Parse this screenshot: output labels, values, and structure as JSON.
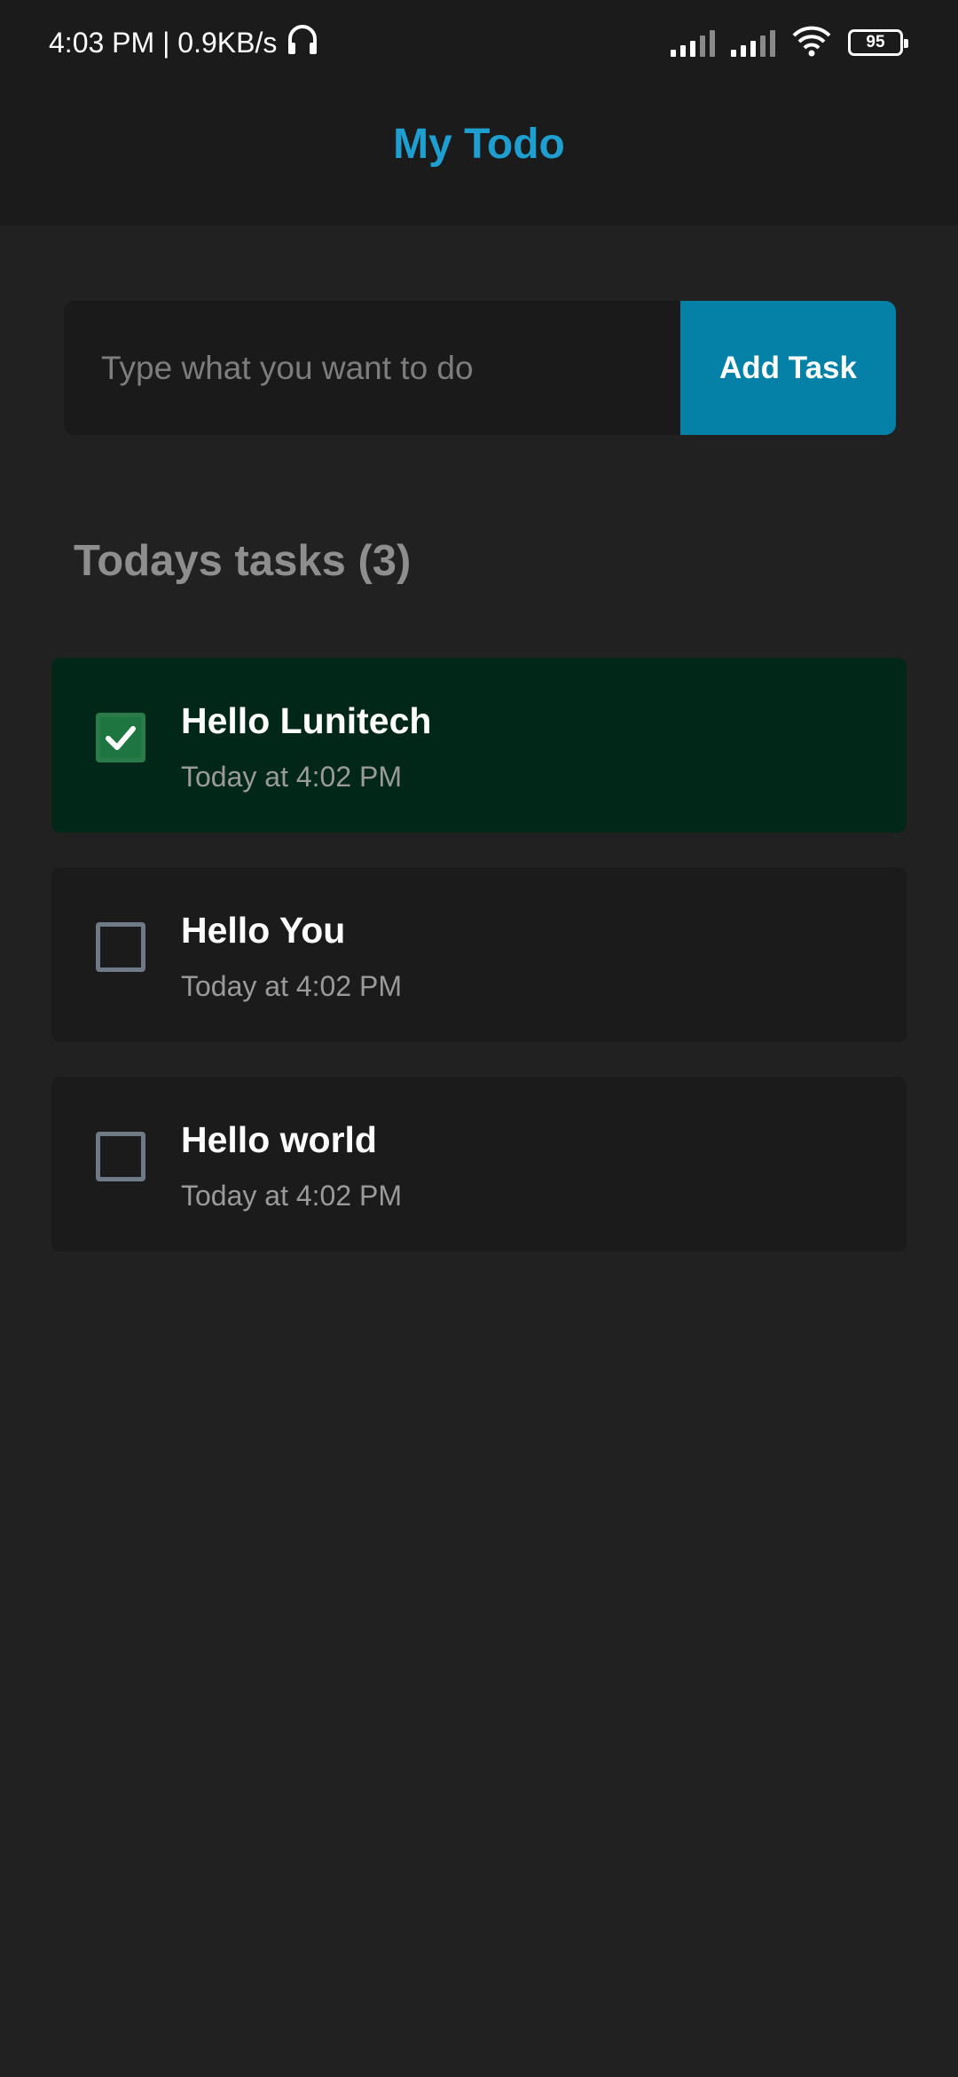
{
  "status_bar": {
    "time_speed": "4:03 PM | 0.9KB/s",
    "battery": "95"
  },
  "header": {
    "title": "My Todo"
  },
  "input": {
    "placeholder": "Type what you want to do",
    "value": "",
    "add_button_label": "Add Task"
  },
  "section": {
    "heading": "Todays tasks (3)"
  },
  "tasks": [
    {
      "title": "Hello Lunitech",
      "time": "Today at 4:02 PM",
      "done": true
    },
    {
      "title": "Hello You",
      "time": "Today at 4:02 PM",
      "done": false
    },
    {
      "title": "Hello world",
      "time": "Today at 4:02 PM",
      "done": false
    }
  ],
  "colors": {
    "accent": "#1e9fd0",
    "button": "#0580a6",
    "done_bg": "#002717",
    "check_green": "#1d7540"
  }
}
